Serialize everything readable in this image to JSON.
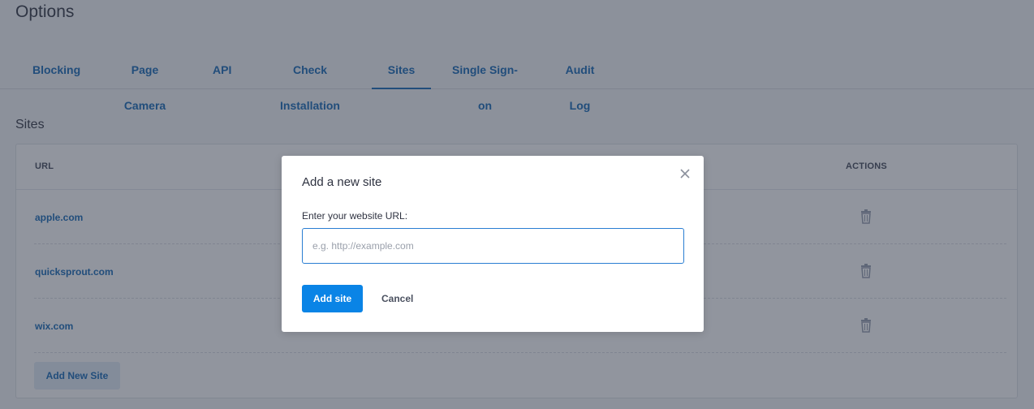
{
  "page": {
    "title": "Options"
  },
  "tabs": [
    {
      "label": "Blocking"
    },
    {
      "label": "Page Camera"
    },
    {
      "label": "API"
    },
    {
      "label": "Check Installation"
    },
    {
      "label": "Sites",
      "active": true
    },
    {
      "label": "Single Sign-on"
    },
    {
      "label": "Audit Log"
    }
  ],
  "sites_section": {
    "title": "Sites",
    "columns": {
      "url": "URL",
      "actions": "ACTIONS"
    },
    "rows": [
      {
        "url": "apple.com"
      },
      {
        "url": "quicksprout.com"
      },
      {
        "url": "wix.com"
      }
    ],
    "add_new_label": "Add New Site"
  },
  "modal": {
    "title": "Add a new site",
    "field_label": "Enter your website URL:",
    "input_value": "",
    "input_placeholder": "e.g. http://example.com",
    "submit_label": "Add site",
    "cancel_label": "Cancel"
  },
  "colors": {
    "accent": "#1f6fb9",
    "primary_button": "#0a84e6",
    "overlay": "rgba(36,44,62,0.5)"
  },
  "icons": {
    "row_action": "trash-icon",
    "modal_close": "close-icon"
  }
}
